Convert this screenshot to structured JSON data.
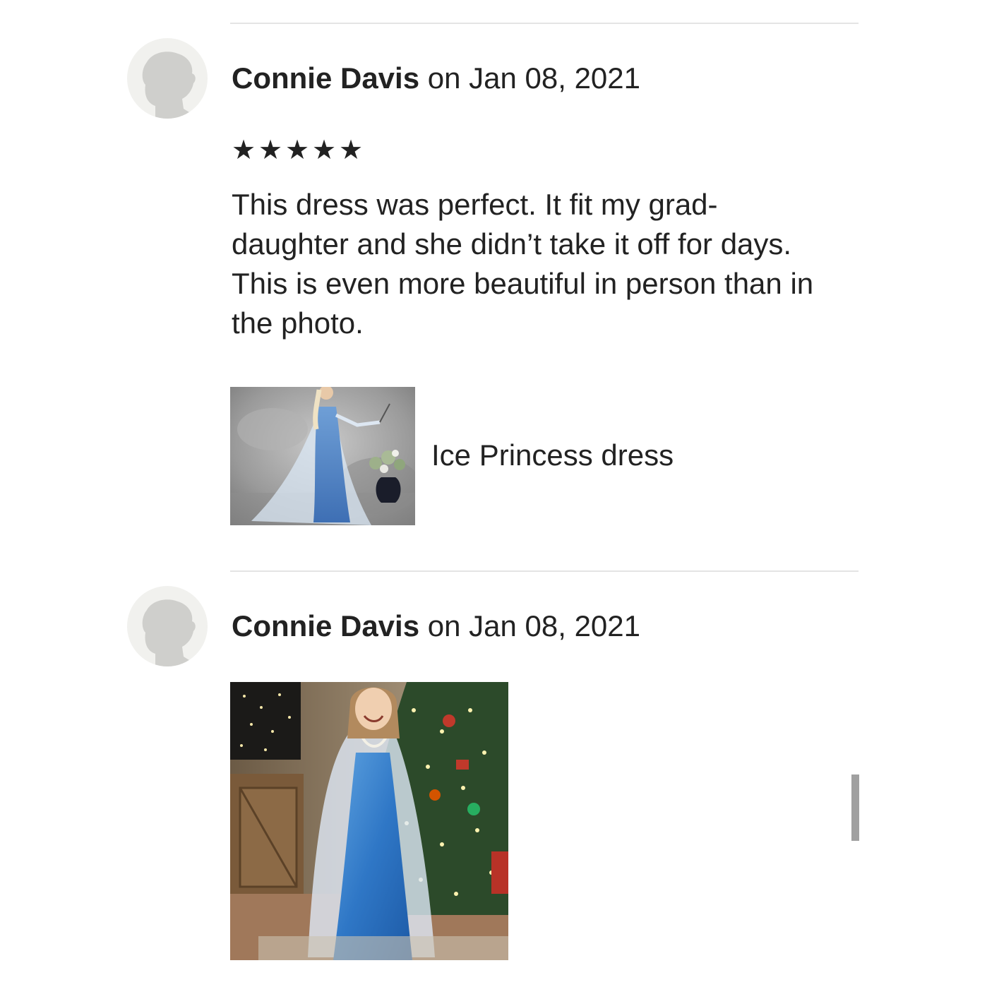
{
  "reviews": [
    {
      "reviewer": "Connie Davis",
      "date_text": " on Jan 08, 2021",
      "rating": 5,
      "rating_max": 5,
      "stars": [
        "★",
        "★",
        "★",
        "★",
        "★"
      ],
      "text": "This dress was perfect. It fit my grad-daughter and she didn’t take it off for days. This is even more beautiful in person than in the photo.",
      "item_title": "Ice Princess dress",
      "avatar_icon": "default-user-icon"
    },
    {
      "reviewer": "Connie Davis",
      "date_text": " on Jan 08, 2021",
      "avatar_icon": "default-user-icon"
    }
  ],
  "colors": {
    "text": "#222222",
    "divider": "#e4e4e4",
    "avatar_bg": "#f1f1ee",
    "avatar_silhouette": "#cfcfcc",
    "scrollbar": "#a0a0a0"
  }
}
